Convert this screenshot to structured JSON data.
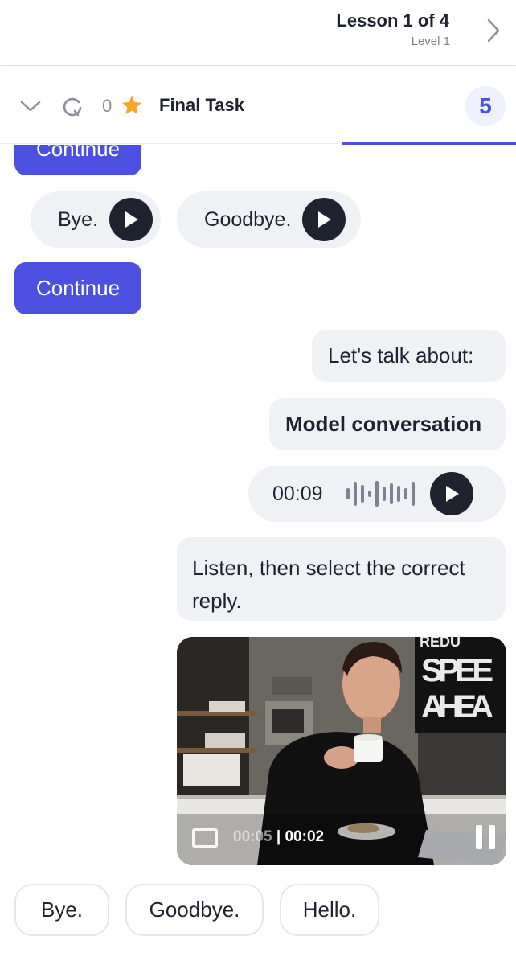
{
  "header": {
    "lesson_title": "Lesson 1 of 4",
    "level": "Level 1",
    "next_icon": "chevron-right-icon"
  },
  "taskbar": {
    "collapse_icon": "chevron-down-icon",
    "refresh_icon": "refresh-icon",
    "score": "0",
    "star_icon": "star-icon",
    "title": "Final Task",
    "count": "5",
    "colors": {
      "accent": "#4b50e0",
      "star": "#f5a623"
    }
  },
  "chat": {
    "continue_top_label": "Continue",
    "audio_options_top": [
      {
        "label": "Bye."
      },
      {
        "label": "Goodbye."
      }
    ],
    "continue_label": "Continue",
    "bubble_talk": "Let's talk about:",
    "bubble_topic": "Model conversation",
    "voice": {
      "time": "00:09"
    },
    "bubble_instruction": "Listen, then select the correct reply.",
    "video": {
      "sign_line1": "SPEE",
      "sign_line2": "AHEA",
      "sign_top": "REDU",
      "current_time": "00:05",
      "separator": " | ",
      "duration": "00:02"
    },
    "reply_options": [
      {
        "label": "Bye."
      },
      {
        "label": "Goodbye."
      },
      {
        "label": "Hello."
      }
    ]
  }
}
